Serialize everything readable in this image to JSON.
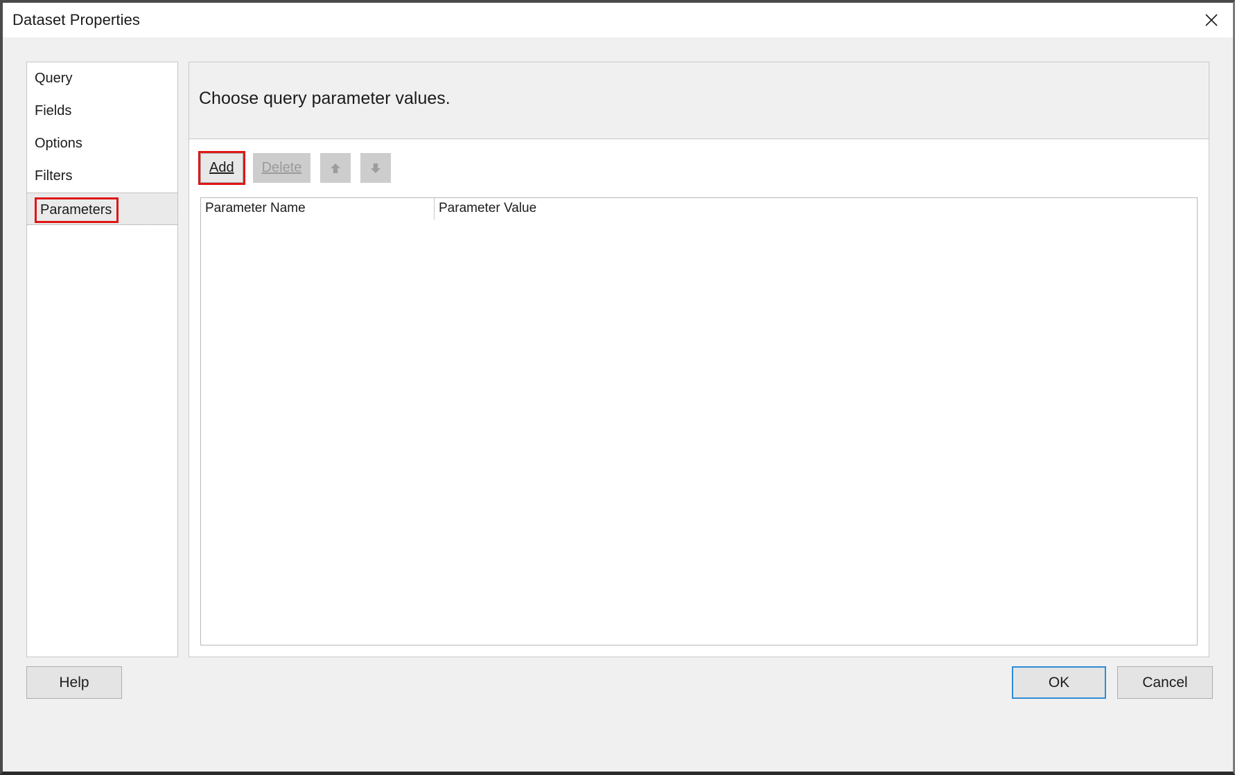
{
  "window": {
    "title": "Dataset Properties",
    "close_icon": "close-icon"
  },
  "sidebar": {
    "items": [
      {
        "label": "Query",
        "selected": false
      },
      {
        "label": "Fields",
        "selected": false
      },
      {
        "label": "Options",
        "selected": false
      },
      {
        "label": "Filters",
        "selected": false
      },
      {
        "label": "Parameters",
        "selected": true
      }
    ]
  },
  "content": {
    "heading": "Choose query parameter values.",
    "toolbar": {
      "add": {
        "label": "Add",
        "accelerator": "A",
        "enabled": true,
        "highlighted": true
      },
      "delete": {
        "label": "Delete",
        "accelerator": "D",
        "enabled": false
      },
      "move_up": {
        "icon": "arrow-up-icon",
        "enabled": false
      },
      "move_down": {
        "icon": "arrow-down-icon",
        "enabled": false
      }
    },
    "grid": {
      "columns": [
        "Parameter Name",
        "Parameter Value"
      ],
      "rows": []
    }
  },
  "footer": {
    "help_label": "Help",
    "ok_label": "OK",
    "cancel_label": "Cancel"
  },
  "annotation": {
    "highlight_color": "#e01616",
    "focus_color": "#2c8cd6"
  }
}
